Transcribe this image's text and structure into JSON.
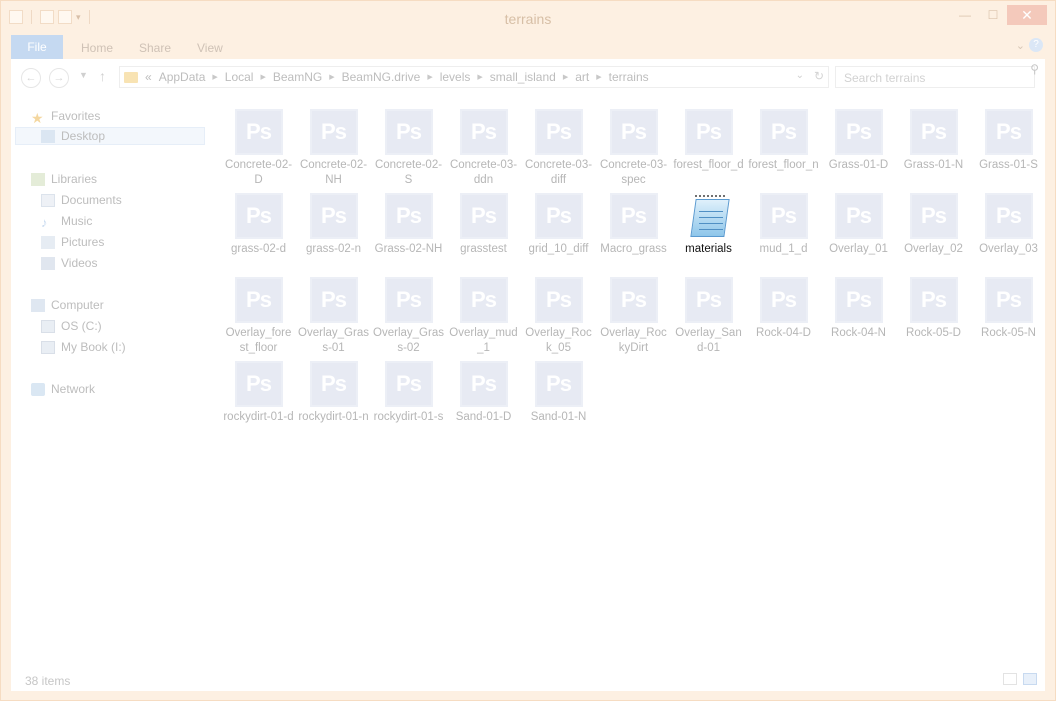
{
  "window": {
    "title": "terrains"
  },
  "ribbon": {
    "tabs": [
      "File",
      "Home",
      "Share",
      "View"
    ]
  },
  "address": {
    "breadcrumb_prefix": "«",
    "crumbs": [
      "AppData",
      "Local",
      "BeamNG",
      "BeamNG.drive",
      "levels",
      "small_island",
      "art",
      "terrains"
    ]
  },
  "search": {
    "placeholder": "Search terrains"
  },
  "nav": {
    "favorites": "Favorites",
    "desktop": "Desktop",
    "libraries": "Libraries",
    "documents": "Documents",
    "music": "Music",
    "pictures": "Pictures",
    "videos": "Videos",
    "computer": "Computer",
    "os_drive": "OS (C:)",
    "mybook": "My Book (I:)",
    "network": "Network"
  },
  "files": [
    {
      "name": "Concrete-02-D",
      "icon": "ps"
    },
    {
      "name": "Concrete-02-NH",
      "icon": "ps"
    },
    {
      "name": "Concrete-02-S",
      "icon": "ps"
    },
    {
      "name": "Concrete-03-ddn",
      "icon": "ps"
    },
    {
      "name": "Concrete-03-diff",
      "icon": "ps"
    },
    {
      "name": "Concrete-03-spec",
      "icon": "ps"
    },
    {
      "name": "forest_floor_d",
      "icon": "ps"
    },
    {
      "name": "forest_floor_n",
      "icon": "ps"
    },
    {
      "name": "Grass-01-D",
      "icon": "ps"
    },
    {
      "name": "Grass-01-N",
      "icon": "ps"
    },
    {
      "name": "Grass-01-S",
      "icon": "ps"
    },
    {
      "name": "grass-02-d",
      "icon": "ps"
    },
    {
      "name": "grass-02-n",
      "icon": "ps"
    },
    {
      "name": "Grass-02-NH",
      "icon": "ps"
    },
    {
      "name": "grasstest",
      "icon": "ps"
    },
    {
      "name": "grid_10_diff",
      "icon": "ps"
    },
    {
      "name": "Macro_grass",
      "icon": "ps"
    },
    {
      "name": "materials",
      "icon": "notepad"
    },
    {
      "name": "mud_1_d",
      "icon": "ps"
    },
    {
      "name": "Overlay_01",
      "icon": "ps"
    },
    {
      "name": "Overlay_02",
      "icon": "ps"
    },
    {
      "name": "Overlay_03",
      "icon": "ps"
    },
    {
      "name": "Overlay_forest_floor",
      "icon": "ps"
    },
    {
      "name": "Overlay_Grass-01",
      "icon": "ps"
    },
    {
      "name": "Overlay_Grass-02",
      "icon": "ps"
    },
    {
      "name": "Overlay_mud_1",
      "icon": "ps"
    },
    {
      "name": "Overlay_Rock_05",
      "icon": "ps"
    },
    {
      "name": "Overlay_RockyDirt",
      "icon": "ps"
    },
    {
      "name": "Overlay_Sand-01",
      "icon": "ps"
    },
    {
      "name": "Rock-04-D",
      "icon": "ps"
    },
    {
      "name": "Rock-04-N",
      "icon": "ps"
    },
    {
      "name": "Rock-05-D",
      "icon": "ps"
    },
    {
      "name": "Rock-05-N",
      "icon": "ps"
    },
    {
      "name": "rockydirt-01-d",
      "icon": "ps"
    },
    {
      "name": "rockydirt-01-n",
      "icon": "ps"
    },
    {
      "name": "rockydirt-01-s",
      "icon": "ps"
    },
    {
      "name": "Sand-01-D",
      "icon": "ps"
    },
    {
      "name": "Sand-01-N",
      "icon": "ps"
    }
  ],
  "icons": {
    "ps_label": "Ps"
  },
  "status": {
    "item_count": "38 items"
  },
  "colors": {
    "accent": "#c5d9f1",
    "window_frame": "#fdf0e2",
    "close": "#f4c9bb"
  }
}
